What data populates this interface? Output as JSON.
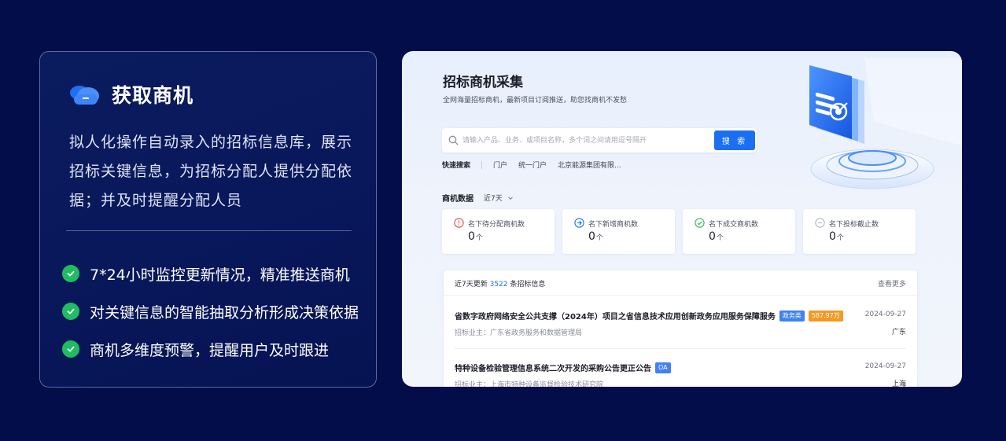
{
  "info_card": {
    "title": "获取商机",
    "icon": "cloud-icon",
    "description": "拟人化操作自动录入的招标信息库，展示招标关键信息，为招标分配人提供分配依据；并及时提醒分配人员",
    "features": [
      "7*24小时监控更新情况，精准推送商机",
      "对关键信息的智能抽取分析形成决策依据",
      "商机多维度预警，提醒用户及时跟进"
    ],
    "check_color": "#1fbd62"
  },
  "app": {
    "title": "招标商机采集",
    "subtitle": "全网海量招标商机，最新项目订阅推送，助您找商机不发愁",
    "search": {
      "placeholder": "请输入产品、业务、或项目名称，多个词之间请用逗号隔开",
      "value": "",
      "button_label": "搜 索"
    },
    "quick_search": {
      "label": "快速搜索",
      "tags": [
        "门户",
        "统一门户",
        "北京能源集团有限..."
      ]
    },
    "stats": {
      "title": "商机数据",
      "range": "近7天",
      "cards": [
        {
          "label": "名下待分配商机数",
          "value": "0",
          "unit": "个",
          "icon": "alert-circle-icon",
          "color": "#e5484d"
        },
        {
          "label": "名下新增商机数",
          "value": "0",
          "unit": "个",
          "icon": "arrow-right-circle-icon",
          "color": "#1a6ff2"
        },
        {
          "label": "名下成交商机数",
          "value": "0",
          "unit": "个",
          "icon": "check-circle-icon",
          "color": "#2fb865"
        },
        {
          "label": "名下投标截止数",
          "value": "0",
          "unit": "个",
          "icon": "minus-circle-icon",
          "color": "#b0b4bd"
        }
      ]
    },
    "list": {
      "prefix": "近7天更新 ",
      "count": "3522",
      "suffix": " 条招标信息",
      "more": "查看更多",
      "items": [
        {
          "title": "省数字政府网络安全公共支撑（2024年）项目之省信息技术应用创新政务应用服务保障服务",
          "tags": [
            {
              "text": "政务类",
              "color": "#3f82f3"
            },
            {
              "text": "587.97万",
              "color": "#f39a23"
            }
          ],
          "owner": "招标业主：广东省政务服务和数据管理局",
          "date": "2024-09-27",
          "region": "广东"
        },
        {
          "title": "特种设备检验管理信息系统二次开发的采购公告更正公告",
          "tags": [
            {
              "text": "OA",
              "color": "#3f82f3"
            }
          ],
          "owner": "招标业主：上海市特种设备监督检验技术研究院",
          "date": "2024-09-27",
          "region": "上海"
        }
      ]
    },
    "accent_color": "#1a6ff2"
  }
}
